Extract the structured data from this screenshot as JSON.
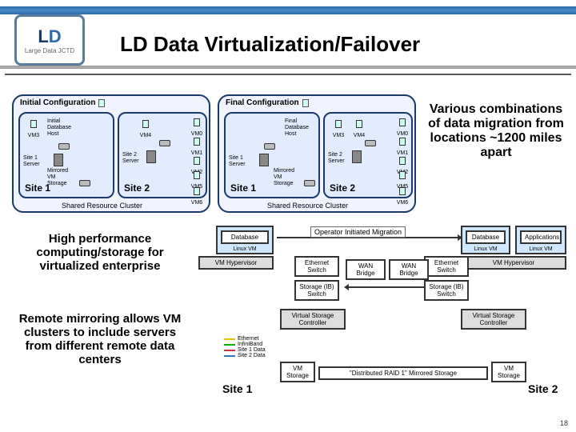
{
  "header": {
    "logo_top": "LD",
    "logo_sub": "Large Data JCTD",
    "title": "LD Data Virtualization/Failover"
  },
  "config_panels": {
    "initial": {
      "title": "Initial Configuration"
    },
    "final": {
      "title": "Final Configuration"
    }
  },
  "sites": {
    "site1_label": "Site 1",
    "site2_label": "Site 2",
    "shared_cluster": "Shared Resource Cluster",
    "vm3": "VM3",
    "vm4": "VM4",
    "vm0": "VM0",
    "vm1": "VM1",
    "vm2": "VM2",
    "vm5": "VM5",
    "vm6": "VM6",
    "initial_db_host": "Initial\nDatabase\nHost",
    "final_db_host": "Final\nDatabase\nHost",
    "site1_server": "Site 1\nServer",
    "site2_server": "Site 2\nServer",
    "mirrored_vm": "Mirrored\nVM\nStorage"
  },
  "side_text": "Various combinations of data migration from locations ~1200 miles apart",
  "left_texts": {
    "hpc": "High performance computing/storage for virtualized enterprise",
    "mirror": "Remote mirroring allows VM clusters to include servers from different remote data centers"
  },
  "lower": {
    "database": "Database",
    "applications": "Applications",
    "linux_vm": "Linux VM",
    "vm_hypervisor": "VM Hypervisor",
    "ethernet_switch": "Ethernet\nSwitch",
    "storage_ib_switch": "Storage (IB)\nSwitch",
    "wan_bridge": "WAN Bridge",
    "virtual_storage_controller": "Virtual Storage\nController",
    "vm_storage": "VM\nStorage",
    "raid": "\"Distributed RAID 1\" Mirrored Storage",
    "site1": "Site 1",
    "site2": "Site 2",
    "operator_migration": "Operator Initiated Migration",
    "legend": {
      "eth": "Ethernet",
      "ib": "InfiniBand",
      "s1": "Site 1 Data",
      "s2": "Site 2 Data"
    }
  },
  "page": "18"
}
